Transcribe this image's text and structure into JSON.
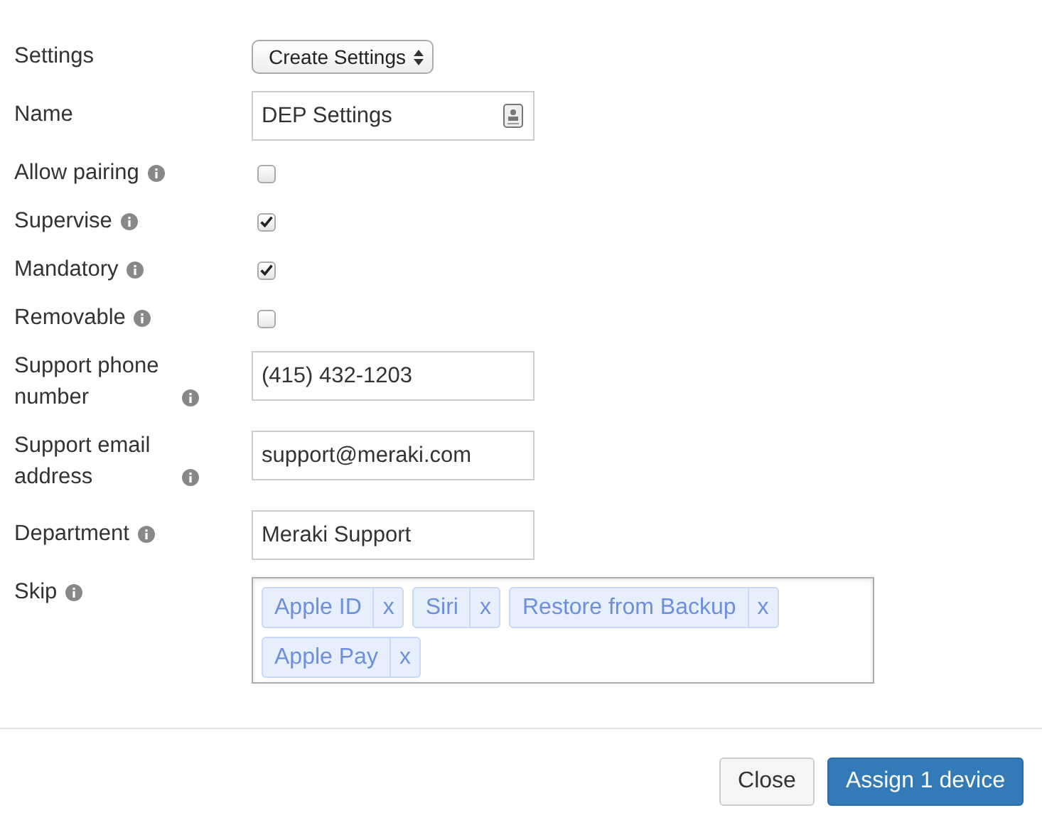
{
  "fields": [
    {
      "kind": "select",
      "label": "Settings",
      "info": false,
      "value": "Create Settings"
    },
    {
      "kind": "text",
      "label": "Name",
      "info": false,
      "value": "DEP Settings",
      "contact_icon": true
    },
    {
      "kind": "checkbox",
      "label": "Allow pairing",
      "info": true,
      "checked": false
    },
    {
      "kind": "checkbox",
      "label": "Supervise",
      "info": true,
      "checked": true
    },
    {
      "kind": "checkbox",
      "label": "Mandatory",
      "info": true,
      "checked": true
    },
    {
      "kind": "checkbox",
      "label": "Removable",
      "info": true,
      "checked": false
    },
    {
      "kind": "text",
      "label": "Support phone number",
      "info": true,
      "value": "(415) 432-1203"
    },
    {
      "kind": "text",
      "label": "Support email address",
      "info": true,
      "value": "support@meraki.com"
    },
    {
      "kind": "text",
      "label": "Department",
      "info": true,
      "value": "Meraki Support"
    },
    {
      "kind": "tags",
      "label": "Skip",
      "info": true,
      "tags": [
        {
          "label": "Apple ID",
          "remove": "x"
        },
        {
          "label": "Siri",
          "remove": "x"
        },
        {
          "label": "Restore from Backup",
          "remove": "x"
        },
        {
          "label": "Apple Pay",
          "remove": "x"
        }
      ]
    }
  ],
  "buttons": [
    {
      "label": "Close",
      "primary": false
    },
    {
      "label": "Assign 1 device",
      "primary": true
    }
  ]
}
